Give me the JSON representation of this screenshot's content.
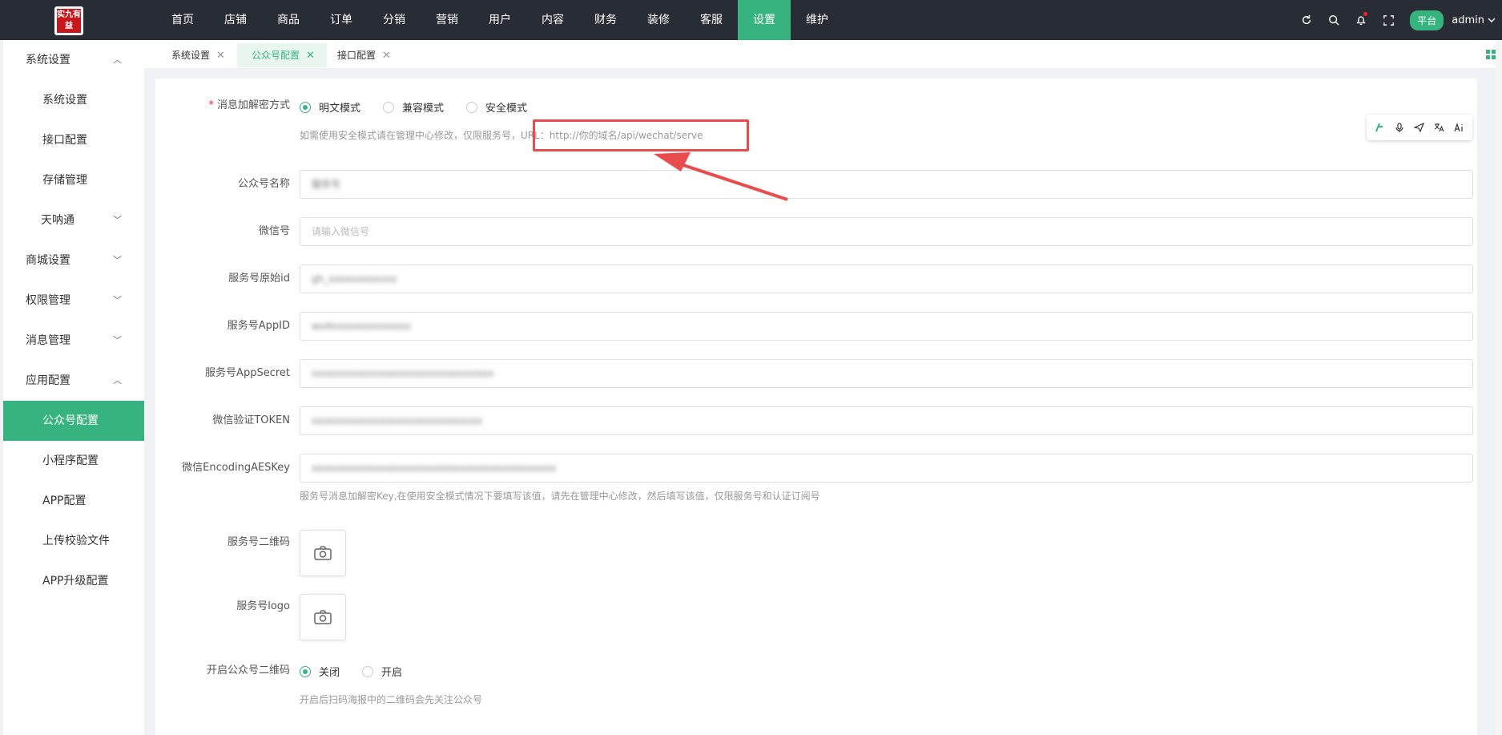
{
  "logo": {
    "text": "实九有益"
  },
  "nav": {
    "items": [
      "首页",
      "店铺",
      "商品",
      "订单",
      "分销",
      "营销",
      "用户",
      "内容",
      "财务",
      "装修",
      "客服",
      "设置",
      "维护"
    ],
    "active_index": 11
  },
  "topbar": {
    "platform_label": "平台",
    "user_name": "admin"
  },
  "sidebar": {
    "items": [
      {
        "label": "系统设置",
        "type": "group",
        "expanded": true
      },
      {
        "label": "系统设置",
        "type": "sub"
      },
      {
        "label": "接口配置",
        "type": "sub"
      },
      {
        "label": "存储管理",
        "type": "sub"
      },
      {
        "label": "天呐通",
        "type": "sub",
        "expandable": true
      },
      {
        "label": "商城设置",
        "type": "group",
        "expanded": false
      },
      {
        "label": "权限管理",
        "type": "group",
        "expanded": false
      },
      {
        "label": "消息管理",
        "type": "group",
        "expanded": false
      },
      {
        "label": "应用配置",
        "type": "group",
        "expanded": true
      },
      {
        "label": "公众号配置",
        "type": "sub",
        "active": true
      },
      {
        "label": "小程序配置",
        "type": "sub"
      },
      {
        "label": "APP配置",
        "type": "sub"
      },
      {
        "label": "上传校验文件",
        "type": "sub"
      },
      {
        "label": "APP升级配置",
        "type": "sub"
      }
    ]
  },
  "tabs": [
    {
      "label": "系统设置",
      "active": false
    },
    {
      "label": "公众号配置",
      "active": true
    },
    {
      "label": "接口配置",
      "active": false
    }
  ],
  "form": {
    "encrypt_mode": {
      "label": "消息加解密方式",
      "required": true,
      "options": [
        "明文模式",
        "兼容模式",
        "安全模式"
      ],
      "selected": "明文模式",
      "hint": "如需使用安全模式请在管理中心修改，仅限服务号，URL：http://你的域名/api/wechat/serve"
    },
    "account_name": {
      "label": "公众号名称",
      "value": "服务号"
    },
    "wechat_id": {
      "label": "微信号",
      "placeholder": "请输入微信号"
    },
    "origin_id": {
      "label": "服务号原始id",
      "value": "gh_xxxxxxxxxxxx"
    },
    "app_id": {
      "label": "服务号AppID",
      "value": "wx4xxxxxxxxxxxxxx"
    },
    "app_secret": {
      "label": "服务号AppSecret",
      "value": "xxxxxxxxxxxxxxxxxxxxxxxxxxxxxxxx"
    },
    "token": {
      "label": "微信验证TOKEN",
      "value": "xxxxxxxxxxxxxxxxxxxxxxxxxxxxxx"
    },
    "aes_key": {
      "label": "微信EncodingAESKey",
      "value": "xxxxxxxxxxxxxxxxxxxxxxxxxxxxxxxxxxxxxxxxxxx",
      "hint": "服务号消息加解密Key,在使用安全模式情况下要填写该值，请先在管理中心修改，然后填写该值，仅限服务号和认证订阅号"
    },
    "qrcode": {
      "label": "服务号二维码"
    },
    "logo": {
      "label": "服务号logo"
    },
    "enable_qrcode": {
      "label": "开启公众号二维码",
      "options": [
        "关闭",
        "开启"
      ],
      "selected": "关闭",
      "hint": "开启后扫码海报中的二维码会先关注公众号"
    }
  },
  "colors": {
    "accent": "#36b37e",
    "topbar_bg": "#282c34",
    "highlight": "#e84c4c"
  }
}
